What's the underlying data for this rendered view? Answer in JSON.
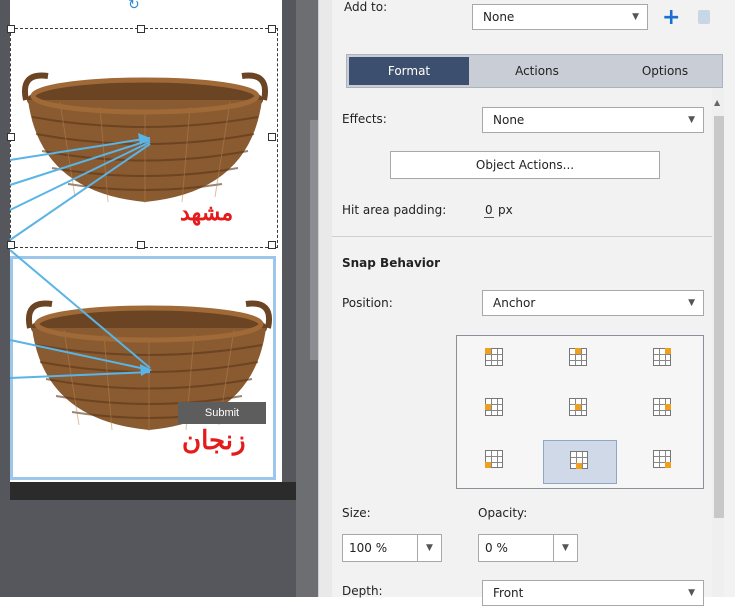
{
  "canvas": {
    "label_top": "مشهد",
    "label_bottom": "زنجان",
    "submit_label": "Submit"
  },
  "panel": {
    "add_to": {
      "label": "Add to:",
      "value": "None"
    },
    "tabs": [
      {
        "label": "Format",
        "selected": true
      },
      {
        "label": "Actions",
        "selected": false
      },
      {
        "label": "Options",
        "selected": false
      }
    ],
    "effects": {
      "label": "Effects:",
      "value": "None"
    },
    "object_actions_label": "Object Actions...",
    "hit_area": {
      "label": "Hit area padding:",
      "value": "0",
      "unit": "px"
    },
    "snap_behavior_heading": "Snap Behavior",
    "position": {
      "label": "Position:",
      "value": "Anchor"
    },
    "anchor_grid": {
      "selected": "bottom-center"
    },
    "size": {
      "label": "Size:",
      "value": "100 %"
    },
    "opacity": {
      "label": "Opacity:",
      "value": "0 %"
    },
    "depth": {
      "label": "Depth:",
      "value": "Front"
    }
  },
  "colors": {
    "tab_selected_bg": "#3d4f6e",
    "label_red": "#e41b1b",
    "arrow_blue": "#5ab4e6",
    "anchor_dot": "#f0a020"
  }
}
